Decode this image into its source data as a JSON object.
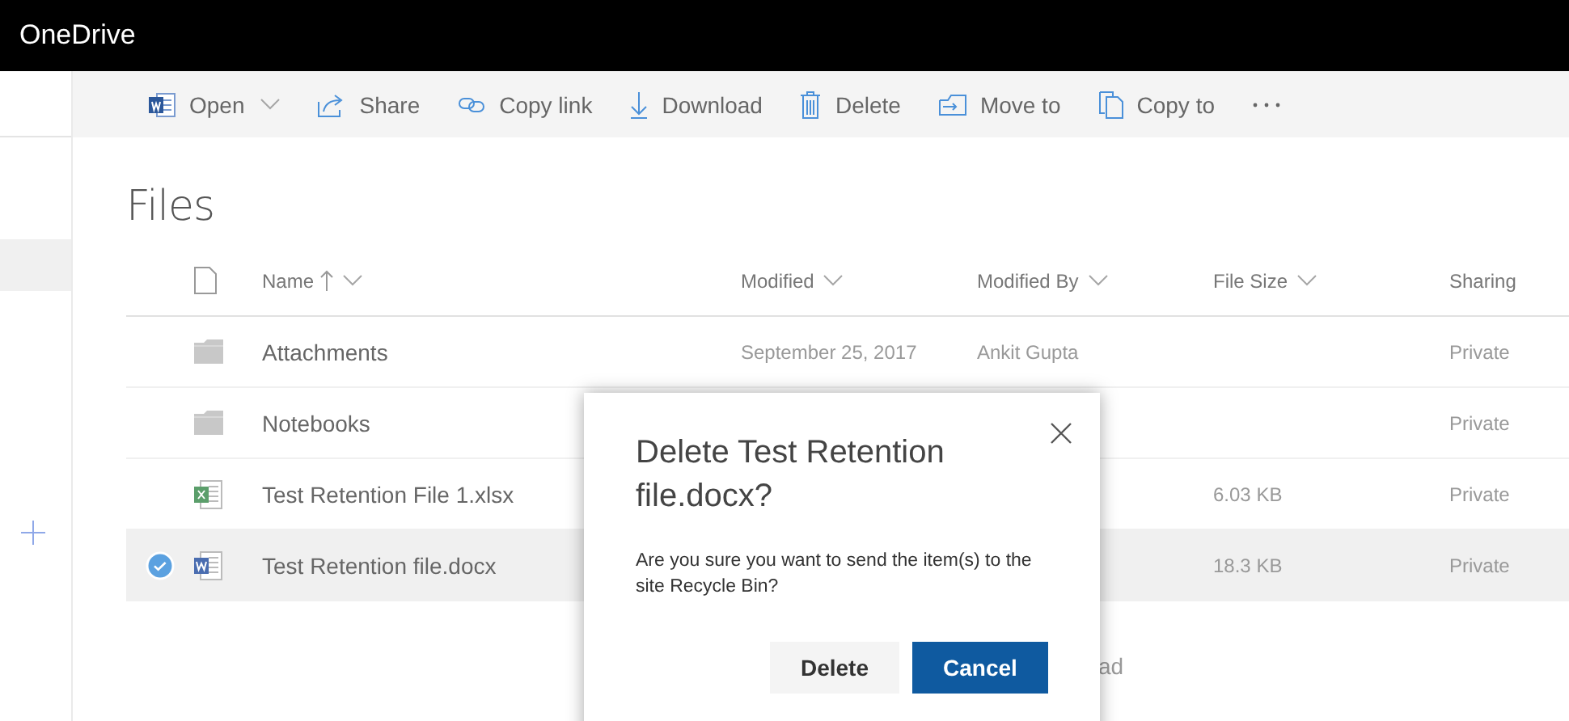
{
  "app": {
    "title": "OneDrive"
  },
  "nav": {
    "items": [
      {
        "selected": true
      }
    ]
  },
  "commands": [
    {
      "kind": "word",
      "label": "Open",
      "dropdown": true
    },
    {
      "kind": "share",
      "label": "Share",
      "dropdown": false
    },
    {
      "kind": "link",
      "label": "Copy link",
      "dropdown": false
    },
    {
      "kind": "download",
      "label": "Download",
      "dropdown": false
    },
    {
      "kind": "trash",
      "label": "Delete",
      "dropdown": false
    },
    {
      "kind": "move",
      "label": "Move to",
      "dropdown": false
    },
    {
      "kind": "copy",
      "label": "Copy to",
      "dropdown": false
    },
    {
      "kind": "more",
      "dropdown": false
    }
  ],
  "page_title": "Files",
  "columns": [
    {
      "label": "Name",
      "sorted": true,
      "menu": true
    },
    {
      "label": "Modified",
      "sorted": false,
      "menu": true
    },
    {
      "label": "Modified By",
      "sorted": false,
      "menu": true
    },
    {
      "label": "File Size",
      "sorted": false,
      "menu": true
    },
    {
      "label": "Sharing",
      "sorted": false,
      "menu": false
    }
  ],
  "rows": [
    {
      "kind": "folder",
      "name": "Attachments",
      "modified": "September 25, 2017",
      "modified_by": "Ankit Gupta",
      "sharing": "Private",
      "selected": false
    },
    {
      "kind": "folder",
      "name": "Notebooks",
      "sharing": "Private",
      "selected": false
    },
    {
      "kind": "excel",
      "name": "Test Retention File 1.xlsx",
      "size": "6.03 KB",
      "sharing": "Private",
      "selected": false
    },
    {
      "kind": "word",
      "name": "Test Retention file.docx",
      "size": "18.3 KB",
      "sharing": "Private",
      "selected": true
    }
  ],
  "hint": "ad",
  "dialog": {
    "title": "Delete Test Retention file.docx?",
    "message": "Are you sure you want to send the item(s) to the site Recycle Bin?",
    "buttons": [
      {
        "label": "Delete",
        "primary": false
      },
      {
        "label": "Cancel",
        "primary": true
      }
    ]
  }
}
